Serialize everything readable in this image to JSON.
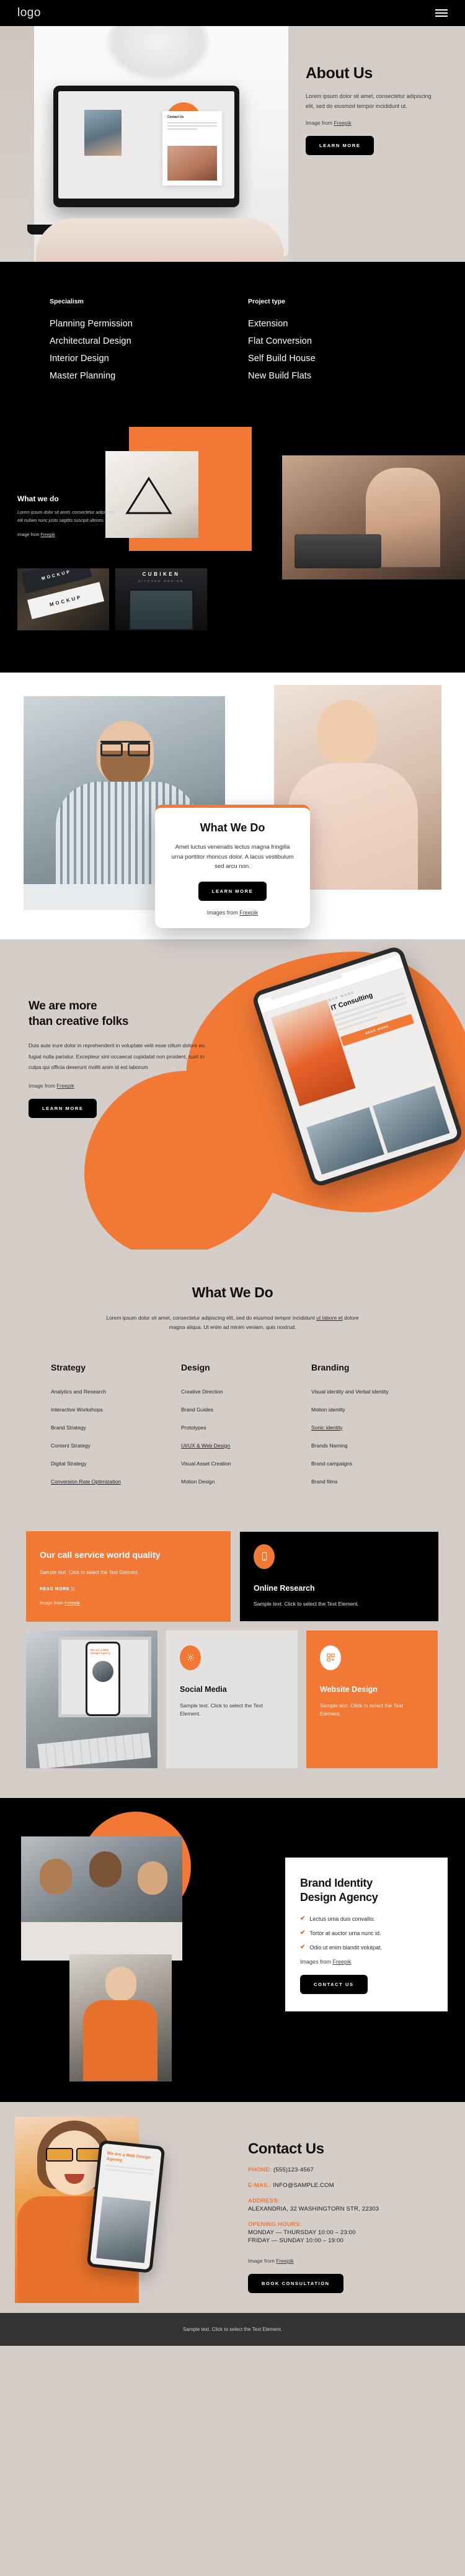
{
  "nav": {
    "logo": "logo",
    "menu_icon": "hamburger-menu-icon"
  },
  "hero": {
    "title": "About Us",
    "body": "Lorem ipsum dolor sit amet, consectetur adipiscing elit, sed do eiusmod tempor incididunt ut.",
    "credit_prefix": "Image from ",
    "credit_link": "Freepik",
    "cta": "LEARN MORE",
    "laptop_card_title": "Contact Us"
  },
  "specialism": {
    "columns": [
      {
        "heading": "Specialism",
        "items": [
          "Planning Permission",
          "Architectural Design",
          "Interior Design",
          "Master Planning"
        ]
      },
      {
        "heading": "Project type",
        "items": [
          "Extension",
          "Flat Conversion",
          "Self Build House",
          "New Build Flats"
        ]
      }
    ]
  },
  "what_we_do_dark": {
    "title": "What we do",
    "body": "Lorem ipsum dolor sit amet, consectetur adipiscing elit nullam nunc justo sagittis suscipit ultrices.",
    "credit_prefix": "Image from ",
    "credit_link": "Freepik",
    "thumb_mock_top": "MOCKUP",
    "thumb_mock_bottom": "MOCKUP",
    "thumb_brand_name": "CUBIKEN",
    "thumb_brand_sub": "KITCHEN DESIGN"
  },
  "what_we_do_card": {
    "title": "What We Do",
    "body": "Amet luctus venenatis lectus magna fringilla urna porttitor rhoncus dolor. A lacus vestibulum sed arcu non.",
    "cta": "LEARN MORE",
    "credit_prefix": "Images from ",
    "credit_link": "Freepik"
  },
  "creative": {
    "title_line1": "We are more",
    "title_line2": "than creative folks",
    "body": "Duis aute irure dolor in reprehenderit in voluptate velit esse cillum dolore eu fugiat nulla pariatur. Excepteur sint occaecat cupidatat non proident, sunt in culpa qui officia deserunt mollit anim id est laborum.",
    "credit_prefix": "Image from ",
    "credit_link": "Freepik",
    "cta": "LEARN MORE",
    "tablet_kicker": "OUR WORK",
    "tablet_title": "IT Consulting",
    "tablet_cta": "READ MORE"
  },
  "services_grid": {
    "title": "What We Do",
    "intro_1": "Lorem ipsum dolor sit amet, consectetur adipiscing elit, sed do eiusmod tempor incididunt ",
    "intro_link1": "ut labore et",
    "intro_2": " dolore magna aliqua. Ut enim ad minim veniam, quis nostrud.",
    "columns": [
      {
        "heading": "Strategy",
        "items": [
          {
            "label": "Analytics and Research",
            "link": false
          },
          {
            "label": "Interactive Workshops",
            "link": false
          },
          {
            "label": "Brand Strategy",
            "link": false
          },
          {
            "label": "Content Strategy",
            "link": false
          },
          {
            "label": "Digital Strategy",
            "link": false
          },
          {
            "label": "Conversion Rate Optimization",
            "link": true
          }
        ]
      },
      {
        "heading": "Design",
        "items": [
          {
            "label": "Creative Direction",
            "link": false
          },
          {
            "label": "Brand Guides",
            "link": false
          },
          {
            "label": "Prototypes",
            "link": false
          },
          {
            "label": "UI/UX & Web Design",
            "link": true
          },
          {
            "label": "Visual Asset Creation",
            "link": false
          },
          {
            "label": "Motion Design",
            "link": false
          }
        ]
      },
      {
        "heading": "Branding",
        "items": [
          {
            "label": "Visual identity and Verbal identity",
            "link": false
          },
          {
            "label": "Motion identity",
            "link": false
          },
          {
            "label": "Sonic identity",
            "link": true
          },
          {
            "label": "Brands Naming",
            "link": false
          },
          {
            "label": "Brand campaigns",
            "link": false
          },
          {
            "label": "Brand films",
            "link": false
          }
        ]
      }
    ]
  },
  "service_cards": {
    "call_quality": {
      "title": "Our call service world quality",
      "body": "Sample text. Click to select the Text Element.",
      "read_more": "READ MORE ⟩⟩",
      "credit_prefix": "Image from ",
      "credit_link": "Freepik"
    },
    "online_research": {
      "icon": "mobile-phone-icon",
      "title": "Online Research",
      "body": "Sample text. Click to select the Text Element."
    },
    "social_media": {
      "icon": "gear-icon",
      "title": "Social Media",
      "body": "Sample text. Click to select the Text Element."
    },
    "website_design": {
      "icon": "grid-plus-icon",
      "title": "Website Design",
      "body": "Sample text. Click to select the Text Element."
    },
    "photo_phone_title_1": "We are a ",
    "photo_phone_title_2": "Web Design Agency"
  },
  "brand_identity": {
    "title_line1": "Brand Identity",
    "title_line2": "Design Agency",
    "bullets": [
      "Lectus urna duis convallis.",
      "Tortor at auctor urna nunc id.",
      "Odio ut enim blandit volutpat."
    ],
    "credit_prefix": "Images from ",
    "credit_link": "Freepik",
    "cta": "CONTACT US"
  },
  "contact": {
    "title": "Contact Us",
    "phone_label": "PHONE:",
    "phone_value": "(555)123-4567",
    "email_label": "E-MAIL:",
    "email_value": "INFO@SAMPLE.COM",
    "address_label": "ADDRESS:",
    "address_value": "ALEXANDRIA, 32 WASHINGTORN STR, 22303",
    "hours_label": "OPENING HOURS:",
    "hours_line1": "MONDAY — THURSDAY 10:00 – 23:00",
    "hours_line2": "FRIDAY — SUNDAY 10:00 – 19:00",
    "credit_prefix": "Image from ",
    "credit_link": "Freepik",
    "cta": "BOOK CONSULTATION",
    "phone_mock_title_1": "We are a ",
    "phone_mock_title_2": "Web Design Agency"
  },
  "footer": {
    "text": "Sample text. Click to select the Text Element."
  },
  "colors": {
    "orange": "#f27935",
    "beige": "#d5cdc8",
    "black": "#000000",
    "footer": "#333333"
  }
}
